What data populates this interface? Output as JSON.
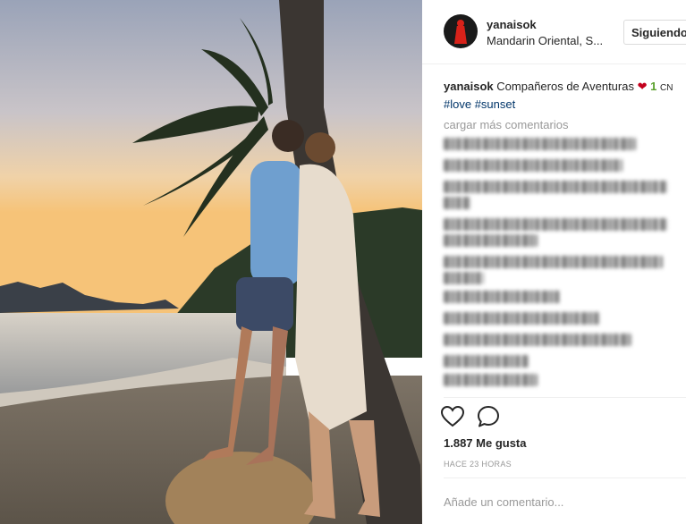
{
  "post": {
    "username": "yanaisok",
    "location": "Mandarin Oriental, S...",
    "follow_label": "Siguiendo",
    "caption_user": "yanaisok",
    "caption_text": "Compañeros de Aventuras",
    "caption_emoji_heart": "❤",
    "caption_emoji_one": "1",
    "caption_trail": "CN",
    "hashtags": [
      "#love",
      "#sunset"
    ],
    "load_more": "cargar más comentarios",
    "likes": "1.887 Me gusta",
    "time": "HACE 23 HORAS",
    "add_comment_placeholder": "Añade un comentario..."
  },
  "icons": {
    "like": "heart-icon",
    "comment": "comment-bubble-icon",
    "avatar": "profile-avatar"
  },
  "colors": {
    "link": "#003569",
    "muted": "#999999",
    "text": "#262626",
    "border": "#dbdbdb"
  }
}
